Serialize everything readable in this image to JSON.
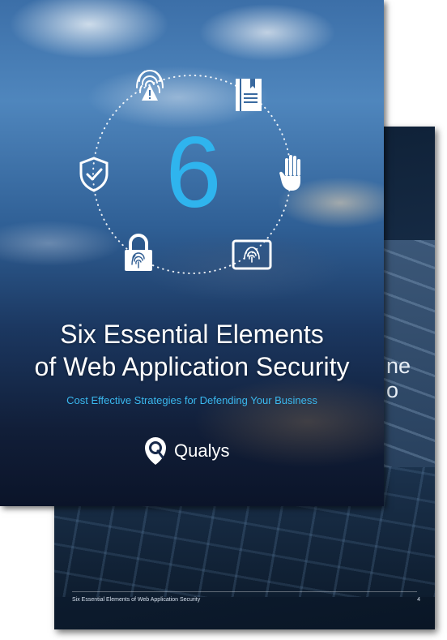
{
  "cover": {
    "number": "6",
    "title_line1": "Six Essential Elements",
    "title_line2": "of Web Application Security",
    "subtitle": "Cost Effective Strategies for Defending Your Business",
    "logo_text": "Qualys",
    "number_color": "#2fb4ee",
    "subtitle_color": "#3ab8ee",
    "icons": [
      "fingerprint-warning-icon",
      "book-icon",
      "hand-icon",
      "tablet-fingerprint-icon",
      "padlock-fingerprint-icon",
      "shield-check-icon"
    ]
  },
  "back_page": {
    "partial_text_line1": "ne",
    "partial_text_line2": "o",
    "footer_title": "Six Essential Elements of Web Application Security",
    "page_number": "4"
  }
}
